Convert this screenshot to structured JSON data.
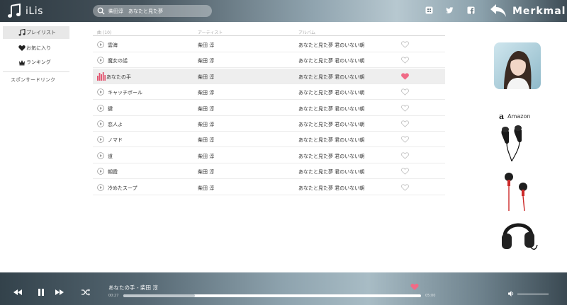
{
  "app": {
    "name": "iLis",
    "brand": "Merkmal"
  },
  "search": {
    "value": "柴田淳　あなたと見た夢"
  },
  "header_icons": [
    "apps-icon",
    "twitter-icon",
    "facebook-icon",
    "back-arrow-icon"
  ],
  "sidebar": {
    "items": [
      {
        "label": "プレイリスト",
        "icon": "music-note-icon",
        "active": true
      },
      {
        "label": "お気に入り",
        "icon": "heart-icon",
        "active": false
      },
      {
        "label": "ランキング",
        "icon": "crown-icon",
        "active": false
      }
    ],
    "sponsor_label": "スポンサードリンク"
  },
  "table": {
    "headers": {
      "song": "曲 (10)",
      "artist": "アーティスト",
      "album": "アルバム"
    },
    "rows": [
      {
        "song": "雲海",
        "artist": "柴田 淳",
        "album": "あなたと見た夢 君のいない朝",
        "playing": false,
        "liked": false
      },
      {
        "song": "魔女の話",
        "artist": "柴田 淳",
        "album": "あなたと見た夢 君のいない朝",
        "playing": false,
        "liked": false
      },
      {
        "song": "あなたの手",
        "artist": "柴田 淳",
        "album": "あなたと見た夢 君のいない朝",
        "playing": true,
        "liked": true
      },
      {
        "song": "キャッチボール",
        "artist": "柴田 淳",
        "album": "あなたと見た夢 君のいない朝",
        "playing": false,
        "liked": false
      },
      {
        "song": "鍵",
        "artist": "柴田 淳",
        "album": "あなたと見た夢 君のいない朝",
        "playing": false,
        "liked": false
      },
      {
        "song": "恋人よ",
        "artist": "柴田 淳",
        "album": "あなたと見た夢 君のいない朝",
        "playing": false,
        "liked": false
      },
      {
        "song": "ノマド",
        "artist": "柴田 淳",
        "album": "あなたと見た夢 君のいない朝",
        "playing": false,
        "liked": false
      },
      {
        "song": "道",
        "artist": "柴田 淳",
        "album": "あなたと見た夢 君のいない朝",
        "playing": false,
        "liked": false
      },
      {
        "song": "朝霞",
        "artist": "柴田 淳",
        "album": "あなたと見た夢 君のいない朝",
        "playing": false,
        "liked": false
      },
      {
        "song": "冷めたスープ",
        "artist": "柴田 淳",
        "album": "あなたと見た夢 君のいない朝",
        "playing": false,
        "liked": false
      }
    ]
  },
  "ads": {
    "amazon_label": "Amazon"
  },
  "player": {
    "now_playing": "あなたの手 - 柴田 淳",
    "time_elapsed": "00:27",
    "time_total": "05:00",
    "progress_fraction": 0.24,
    "liked": true
  },
  "colors": {
    "accent_heart": "#f06a86",
    "playing_bars": "#e2546f"
  }
}
